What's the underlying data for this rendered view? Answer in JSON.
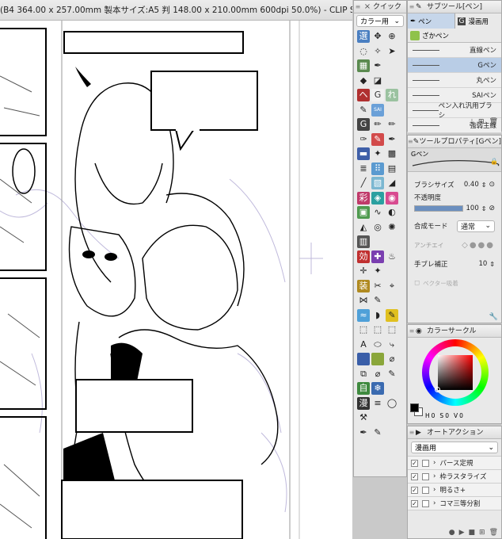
{
  "window": {
    "title": "(B4 364.00 x 257.00mm 製本サイズ:A5 判 148.00 x 210.00mm 600dpi 50.0%) - CLIP STUDIO PAINT EX"
  },
  "quick_panel": {
    "title": "クイック",
    "dropdown": "カラー用"
  },
  "subtool": {
    "title": "サブツール[ペン]",
    "tabs": [
      "ペン",
      "漫画用",
      "ざかペン"
    ],
    "brushes": [
      {
        "name": "直線ペン",
        "selected": false
      },
      {
        "name": "Gペン",
        "selected": true
      },
      {
        "name": "丸ペン",
        "selected": false
      },
      {
        "name": "SAIペン",
        "selected": false
      },
      {
        "name": "ペン入れ汎用ブラシ",
        "selected": false
      },
      {
        "name": "強弱主線",
        "selected": false
      }
    ]
  },
  "tool_property": {
    "title": "ツールプロパティ[Gペン]",
    "preview_label": "Gペン",
    "brush_size_label": "ブラシサイズ",
    "brush_size_value": "0.40",
    "opacity_label": "不透明度",
    "opacity_value": "100",
    "opacity_level": 1.0,
    "blend_label": "合成モード",
    "blend_value": "通常",
    "antialias_label": "アンチエイ",
    "stabilization_label": "手ブレ補正",
    "stabilization_value": "10",
    "vector_label": "ベクター吸着"
  },
  "color_circle": {
    "title": "カラーサークル",
    "h_label": "H",
    "h_value": "0",
    "s_label": "S",
    "s_value": "0",
    "v_label": "V",
    "v_value": "0",
    "main_color": "#000000",
    "sub_color": "#ffffff"
  },
  "auto_action": {
    "title": "オートアクション",
    "dropdown": "漫画用",
    "items": [
      "パース定規",
      "枠ラスタライズ",
      "明るさ+",
      "コマ三等分割"
    ]
  }
}
